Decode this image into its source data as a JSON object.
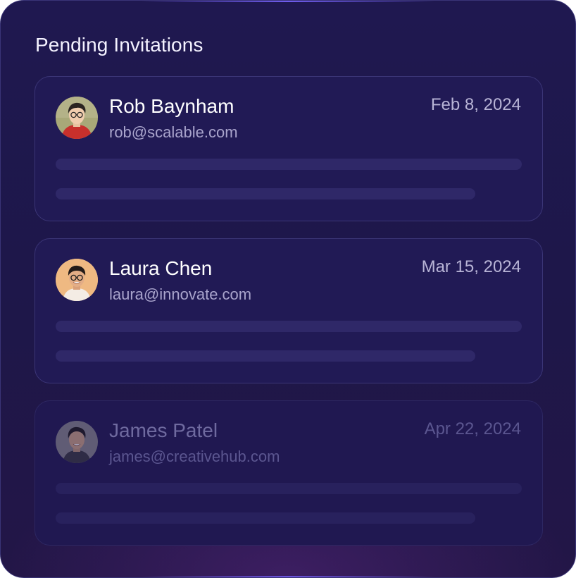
{
  "panel": {
    "title": "Pending Invitations"
  },
  "invitations": [
    {
      "name": "Rob Baynham",
      "email": "rob@scalable.com",
      "date": "Feb 8, 2024",
      "avatar": "avatar-photo"
    },
    {
      "name": "Laura Chen",
      "email": "laura@innovate.com",
      "date": "Mar 15, 2024",
      "avatar": "avatar-photo"
    },
    {
      "name": "James Patel",
      "email": "james@creativehub.com",
      "date": "Apr 22, 2024",
      "avatar": "avatar-photo"
    }
  ],
  "colors": {
    "background": "#1f1850",
    "card_border": "#3b3576",
    "name_text": "#ffffff",
    "email_text": "#a9a4cc",
    "date_text": "#b8b4d6",
    "placeholder_bar": "#2f2868"
  }
}
